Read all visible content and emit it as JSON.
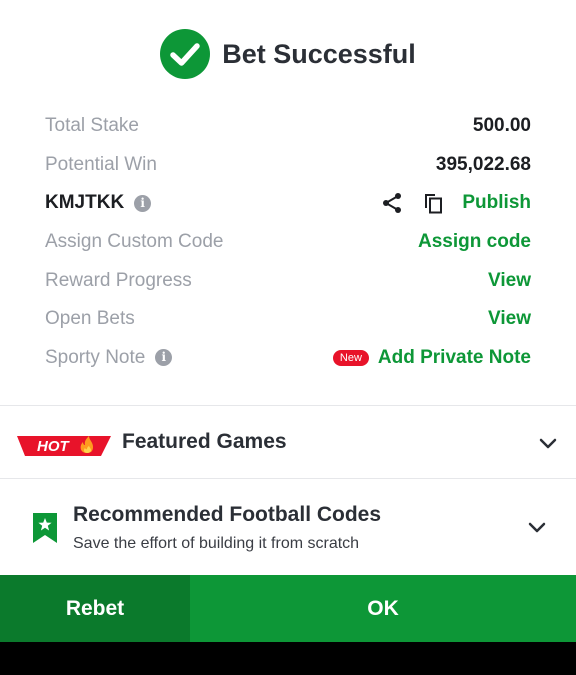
{
  "header": {
    "title": "Bet Successful",
    "icon": "check-circle-icon"
  },
  "details": {
    "total_stake": {
      "label": "Total Stake",
      "value": "500.00"
    },
    "potential_win": {
      "label": "Potential Win",
      "value": "395,022.68"
    },
    "booking_code": {
      "code": "KMJTKK",
      "publish_label": "Publish"
    },
    "custom_code": {
      "label": "Assign Custom Code",
      "action": "Assign code"
    },
    "reward_progress": {
      "label": "Reward Progress",
      "action": "View"
    },
    "open_bets": {
      "label": "Open Bets",
      "action": "View"
    },
    "sporty_note": {
      "label": "Sporty Note",
      "badge": "New",
      "action": "Add Private Note"
    }
  },
  "featured": {
    "badge": "HOT",
    "title": "Featured Games"
  },
  "recommended": {
    "title": "Recommended Football Codes",
    "subtitle": "Save the effort of building it from scratch"
  },
  "footer": {
    "rebet_label": "Rebet",
    "ok_label": "OK"
  },
  "colors": {
    "accent": "#0d9737",
    "accent_dark": "#0b7a2c",
    "badge_red": "#e8132a",
    "muted": "#9ca0a8"
  }
}
